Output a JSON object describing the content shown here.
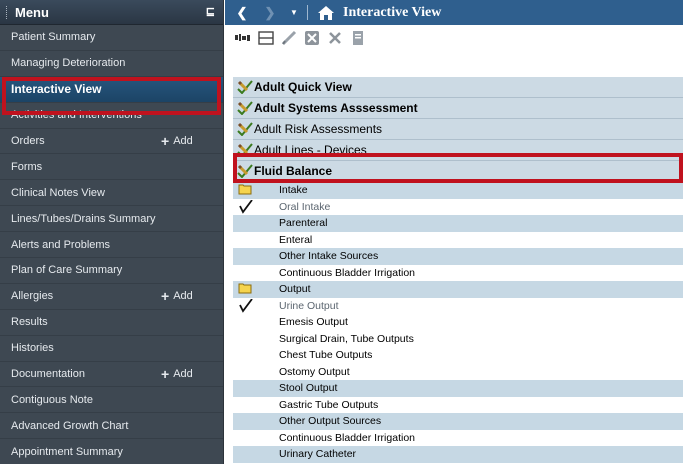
{
  "menu": {
    "title": "Menu",
    "pin": "⊑",
    "add_label": "Add",
    "items": [
      {
        "label": "Patient Summary"
      },
      {
        "label": "Managing Deterioration"
      },
      {
        "label": "Interactive View",
        "active": true
      },
      {
        "label": "Activities and Interventions"
      },
      {
        "label": "Orders",
        "add": true
      },
      {
        "label": "Forms"
      },
      {
        "label": "Clinical Notes View"
      },
      {
        "label": "Lines/Tubes/Drains Summary"
      },
      {
        "label": "Alerts and Problems"
      },
      {
        "label": "Plan of Care Summary"
      },
      {
        "label": "Allergies",
        "add": true
      },
      {
        "label": "Results"
      },
      {
        "label": "Histories"
      },
      {
        "label": "Documentation",
        "add": true
      },
      {
        "label": "Contiguous Note"
      },
      {
        "label": "Advanced Growth Chart"
      },
      {
        "label": "Appointment Summary"
      }
    ]
  },
  "header": {
    "title": "Interactive View",
    "back_icon": "chevron-left-icon",
    "forward_icon": "chevron-right-icon",
    "dropdown_icon": "dropdown-arrow-icon",
    "home_icon": "home-icon"
  },
  "toolbar": {
    "icons": [
      "insert-column-icon",
      "table-grid-icon",
      "sign-check-icon",
      "cancel-x-icon",
      "clear-x-icon",
      "document-icon"
    ]
  },
  "tree": {
    "sections": [
      {
        "label": "Adult Quick View",
        "bold": true
      },
      {
        "label": "Adult Systems Asssessment",
        "bold": true
      },
      {
        "label": "Adult Risk Assessments",
        "bold": false
      },
      {
        "label": "Adult Lines - Devices",
        "bold": false
      },
      {
        "label": "Fluid Balance",
        "bold": true
      }
    ],
    "rows": [
      {
        "label": "Intake",
        "icon": "folder-icon",
        "style": "alt"
      },
      {
        "label": "Oral Intake",
        "icon": "check-icon",
        "style": "white",
        "grey": true
      },
      {
        "label": "Parenteral",
        "style": "alt"
      },
      {
        "label": "Enteral",
        "style": "white"
      },
      {
        "label": "Other Intake Sources",
        "style": "alt"
      },
      {
        "label": "Continuous Bladder Irrigation",
        "style": "white"
      },
      {
        "label": "Output",
        "icon": "folder-icon",
        "style": "alt"
      },
      {
        "label": "Urine Output",
        "icon": "check-icon",
        "style": "white",
        "grey": true
      },
      {
        "label": "Emesis Output",
        "style": "white"
      },
      {
        "label": "Surgical Drain, Tube Outputs",
        "style": "white"
      },
      {
        "label": "Chest Tube Outputs",
        "style": "white"
      },
      {
        "label": "Ostomy Output",
        "style": "white"
      },
      {
        "label": "Stool Output",
        "style": "alt"
      },
      {
        "label": "Gastric Tube Outputs",
        "style": "white"
      },
      {
        "label": "Other Output Sources",
        "style": "alt"
      },
      {
        "label": "Continuous Bladder Irrigation",
        "style": "white"
      },
      {
        "label": "Urinary Catheter",
        "style": "alt"
      }
    ]
  },
  "colors": {
    "sidebar_bg": "#3e4852",
    "header_bg": "#2f5f8e",
    "active_item": "#1f4a70",
    "section_bg": "#ccdae4",
    "highlight": "#c0121e"
  }
}
